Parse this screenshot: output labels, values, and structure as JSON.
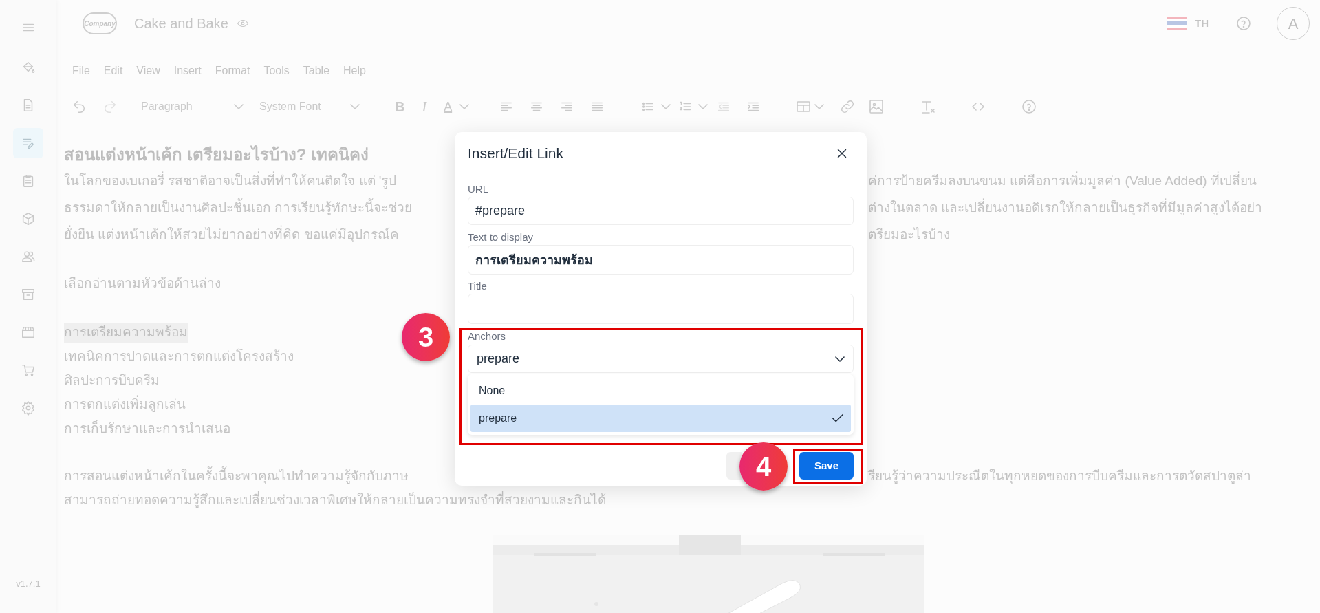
{
  "sidebar": {
    "items": [
      {
        "selected": false
      },
      {
        "selected": false
      },
      {
        "selected": true
      },
      {
        "selected": false
      },
      {
        "selected": false
      },
      {
        "selected": false
      },
      {
        "selected": false
      },
      {
        "selected": false
      },
      {
        "selected": false
      },
      {
        "selected": false
      }
    ],
    "version": "v1.7.1"
  },
  "header": {
    "logo_text": "Company",
    "brand": "Cake and Bake",
    "language": "TH",
    "avatar": "A"
  },
  "menu_bar": [
    "File",
    "Edit",
    "View",
    "Insert",
    "Format",
    "Tools",
    "Table",
    "Help"
  ],
  "toolbar": {
    "block_format": "Paragraph",
    "font": "System Font",
    "format_buttons": [
      "B",
      "I",
      "A"
    ]
  },
  "document": {
    "heading": "สอนแต่งหน้าเค้ก เตรียมอะไรบ้าง? เทคนิคง่",
    "paragraph_lines": [
      {
        "left": "ในโลกของเบเกอรี่ รสชาติอาจเป็นสิ่งที่ทำให้คนติดใจ แต่ 'รูป",
        "right": "ค่การป้ายครีมลงบนขนม แต่คือการเพิ่มมูลค่า (Value Added) ที่เปลี่ยน"
      },
      {
        "left": "ธรรมดาให้กลายเป็นงานศิลปะชิ้นเอก การเรียนรู้ทักษะนี้จะช่วย",
        "right": "ต่างในตลาด และเปลี่ยนงานอดิเรกให้กลายเป็นธุรกิจที่มีมูลค่าสูงได้อย่า"
      },
      {
        "left": "ยั่งยืน แต่งหน้าเค้กให้สวยไม่ยากอย่างที่คิด ขอแค่มีอุปกรณ์ค",
        "right": "ตรียมอะไรบ้าง"
      }
    ],
    "intro": "เลือกอ่านตามหัวข้อด้านล่าง",
    "toc": [
      {
        "text": "การเตรียมความพร้อม",
        "selected": true
      },
      {
        "text": "เทคนิคการปาดและการตกแต่งโครงสร้าง",
        "selected": false
      },
      {
        "text": "ศิลปะการบีบครีม",
        "selected": false
      },
      {
        "text": "การตกแต่งเพิ่มลูกเล่น",
        "selected": false
      },
      {
        "text": "การเก็บรักษาและการนำเสนอ",
        "selected": false
      }
    ],
    "closing_lines": [
      {
        "left": "การสอนแต่งหน้าเค้กในครั้งนี้จะพาคุณไปทำความรู้จักกับภาษ",
        "right": "รียนรู้ว่าความประณีตในทุกหยดของการบีบครีมและการตวัดสปาตูล่า"
      },
      {
        "left": "สามารถถ่ายทอดความรู้สึกและเปลี่ยนช่วงเวลาพิเศษให้กลายเป็นความทรงจำที่สวยงามและกินได้"
      }
    ]
  },
  "dialog": {
    "title": "Insert/Edit Link",
    "fields": [
      {
        "label": "URL",
        "value": "#prepare"
      },
      {
        "label": "Text to display",
        "value": "การเตรียมความพร้อม"
      },
      {
        "label": "Title"
      }
    ],
    "anchors": {
      "label": "Anchors",
      "value": "prepare",
      "options": [
        {
          "label": "None",
          "selected": false
        },
        {
          "label": "prepare",
          "selected": true
        }
      ]
    },
    "save": "Save"
  },
  "annotations": [
    {
      "number": "3"
    },
    {
      "number": "4"
    }
  ]
}
